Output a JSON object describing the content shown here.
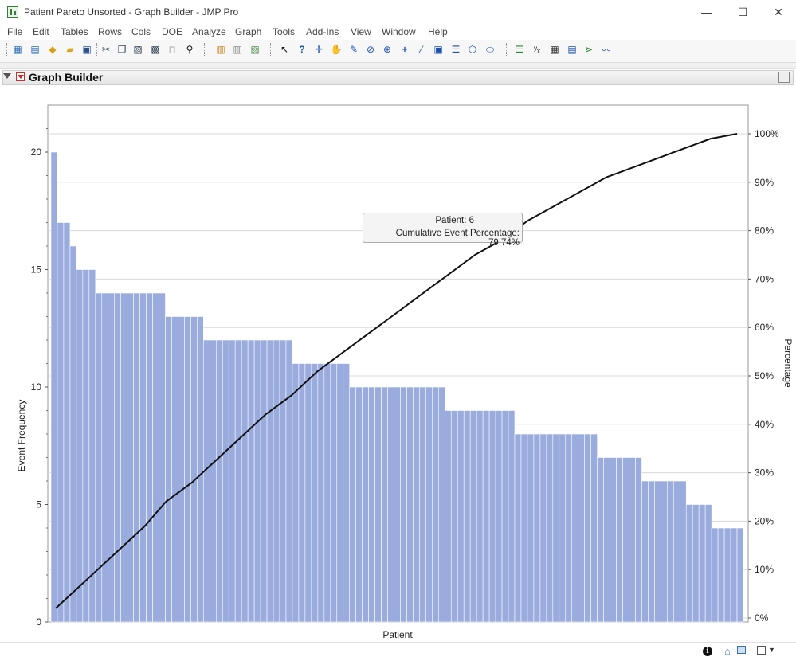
{
  "window": {
    "title": "Patient Pareto Unsorted - Graph Builder - JMP Pro",
    "minimize": "—",
    "maximize": "☐",
    "close": "✕"
  },
  "menu": [
    "File",
    "Edit",
    "Tables",
    "Rows",
    "Cols",
    "DOE",
    "Analyze",
    "Graph",
    "Tools",
    "Add-Ins",
    "View",
    "Window",
    "Help"
  ],
  "toolbar": {
    "icons": [
      "new-data-table",
      "new-script",
      "python",
      "open",
      "save",
      "cut",
      "copy",
      "paste",
      "format",
      "lock",
      "search",
      "columns",
      "rows",
      "split",
      "arrow",
      "help",
      "crosshair",
      "hand",
      "brush",
      "lasso",
      "magnifier",
      "plus",
      "line",
      "annotate",
      "band",
      "polygon",
      "ellipse",
      "bar-chart",
      "formula",
      "table",
      "distribution",
      "control-chart"
    ]
  },
  "panel": {
    "title": "Graph Builder"
  },
  "tooltip": {
    "label1": "Patient:",
    "value1": "6",
    "label2": "Cumulative Event Percentage:",
    "value2": "79.74%"
  },
  "chart_data": {
    "type": "bar",
    "xlabel": "Patient",
    "ylabel": "Event Frequency",
    "y2label": "Percentage",
    "ylim": [
      0,
      22
    ],
    "y2lim": [
      0,
      100
    ],
    "yticks": [
      0,
      5,
      10,
      15,
      20
    ],
    "y2ticks": [
      "0%",
      "10%",
      "20%",
      "30%",
      "40%",
      "50%",
      "60%",
      "70%",
      "80%",
      "90%",
      "100%"
    ],
    "bar_color": "#9aabde",
    "values": [
      20,
      17,
      17,
      16,
      15,
      15,
      15,
      14,
      14,
      14,
      14,
      14,
      14,
      14,
      14,
      14,
      14,
      14,
      13,
      13,
      13,
      13,
      13,
      13,
      12,
      12,
      12,
      12,
      12,
      12,
      12,
      12,
      12,
      12,
      12,
      12,
      12,
      12,
      11,
      11,
      11,
      11,
      11,
      11,
      11,
      11,
      11,
      10,
      10,
      10,
      10,
      10,
      10,
      10,
      10,
      10,
      10,
      10,
      10,
      10,
      10,
      10,
      9,
      9,
      9,
      9,
      9,
      9,
      9,
      9,
      9,
      9,
      9,
      8,
      8,
      8,
      8,
      8,
      8,
      8,
      8,
      8,
      8,
      8,
      8,
      8,
      7,
      7,
      7,
      7,
      7,
      7,
      7,
      6,
      6,
      6,
      6,
      6,
      6,
      6,
      5,
      5,
      5,
      5,
      4,
      4,
      4,
      4,
      4
    ],
    "cumulative_percent": [
      2,
      6,
      10,
      14,
      19,
      24,
      28,
      33,
      37,
      42,
      46,
      51,
      55,
      59,
      63,
      67,
      71,
      75,
      78,
      82,
      85,
      88,
      91,
      93,
      95,
      97,
      99,
      100
    ],
    "cumulative_x_index": [
      0,
      4,
      8,
      12,
      17,
      21,
      26,
      31,
      35,
      40,
      45,
      50,
      55,
      60,
      65,
      70,
      75,
      80,
      85,
      90,
      95,
      100,
      105,
      110,
      115,
      120,
      125,
      130
    ]
  }
}
